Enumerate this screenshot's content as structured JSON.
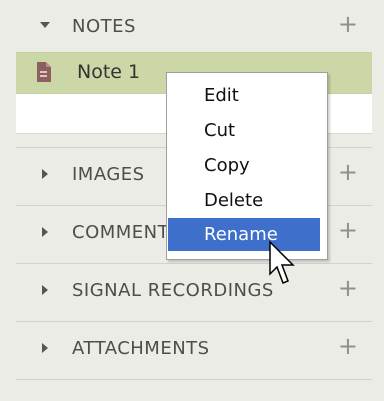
{
  "sections": [
    {
      "id": "notes",
      "label": "NOTES",
      "expanded": true,
      "plus_label": "+"
    },
    {
      "id": "images",
      "label": "IMAGES",
      "expanded": false,
      "plus_label": "+"
    },
    {
      "id": "comments",
      "label": "COMMENTS",
      "expanded": false,
      "plus_label": "+"
    },
    {
      "id": "signal-recordings",
      "label": "SIGNAL RECORDINGS",
      "expanded": false,
      "plus_label": "+"
    },
    {
      "id": "attachments",
      "label": "ATTACHMENTS",
      "expanded": false,
      "plus_label": "+"
    }
  ],
  "notes": {
    "items": [
      {
        "label": "Note 1",
        "icon": "document-icon",
        "selected": true
      }
    ]
  },
  "context_menu": {
    "items": [
      {
        "label": "Edit",
        "highlighted": false
      },
      {
        "label": "Cut",
        "highlighted": false
      },
      {
        "label": "Copy",
        "highlighted": false
      },
      {
        "label": "Delete",
        "highlighted": false
      },
      {
        "label": "Rename",
        "highlighted": true
      }
    ]
  },
  "colors": {
    "panel_bg": "#ecece6",
    "selected_note_bg": "#ccd7a8",
    "menu_highlight": "#3e6fcb",
    "text": "#4d4d4d"
  }
}
